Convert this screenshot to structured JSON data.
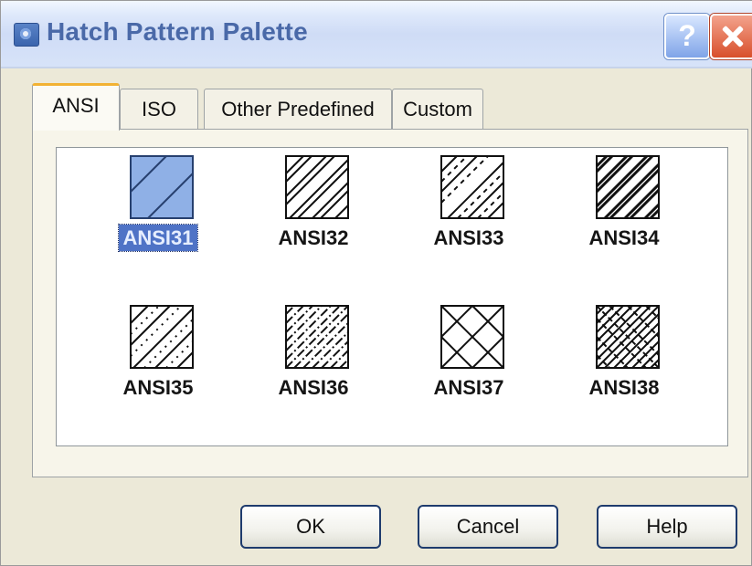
{
  "window": {
    "title": "Hatch Pattern Palette",
    "help_glyph": "?"
  },
  "tabs": [
    {
      "label": "ANSI",
      "active": true
    },
    {
      "label": "ISO",
      "active": false
    },
    {
      "label": "Other Predefined",
      "active": false
    },
    {
      "label": "Custom",
      "active": false
    }
  ],
  "patterns": [
    {
      "name": "ANSI31",
      "selected": true
    },
    {
      "name": "ANSI32",
      "selected": false
    },
    {
      "name": "ANSI33",
      "selected": false
    },
    {
      "name": "ANSI34",
      "selected": false
    },
    {
      "name": "ANSI35",
      "selected": false
    },
    {
      "name": "ANSI36",
      "selected": false
    },
    {
      "name": "ANSI37",
      "selected": false
    },
    {
      "name": "ANSI38",
      "selected": false
    }
  ],
  "buttons": {
    "ok": "OK",
    "cancel": "Cancel",
    "help": "Help"
  },
  "colors": {
    "accent": "#4f73c6",
    "tab_highlight": "#f2b233",
    "title_text": "#4a69a8"
  }
}
